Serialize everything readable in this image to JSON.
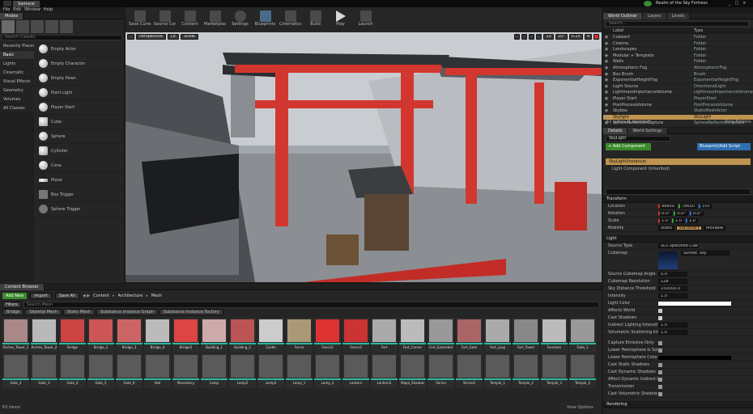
{
  "window": {
    "title": "Realm of the Sky Fortress",
    "tab": "Samurai"
  },
  "menu": [
    "File",
    "Edit",
    "Window",
    "Help"
  ],
  "modes": {
    "tab": "Modes",
    "search_placeholder": "Search Classes",
    "categories": [
      "Recently Placed",
      "Basic",
      "Lights",
      "Cinematic",
      "Visual Effects",
      "Geometry",
      "Volumes",
      "All Classes"
    ],
    "selected_category": 1,
    "items": [
      "Empty Actor",
      "Empty Character",
      "Empty Pawn",
      "Point Light",
      "Player Start",
      "Cube",
      "Sphere",
      "Cylinder",
      "Cone",
      "Plane",
      "Box Trigger",
      "Sphere Trigger"
    ]
  },
  "toolbar": [
    "Save Current",
    "Source Control",
    "Content",
    "Marketplace",
    "Settings",
    "Blueprints",
    "Cinematics",
    "Build",
    "Play",
    "Launch"
  ],
  "viewport": {
    "perspective": "Perspective",
    "lit": "Lit",
    "show": "Show",
    "scale": "10",
    "angle": "10°",
    "snap": "0.25",
    "cam": "4"
  },
  "content_browser": {
    "tab": "Content Browser",
    "add_new": "Add New",
    "import": "Import",
    "save_all": "Save All",
    "path": [
      "Content",
      "Architecture",
      "Mesh"
    ],
    "filters": "Filters",
    "search_placeholder": "Search Mesh",
    "filter_tabs": [
      "Bridge",
      "Skeletal Mesh",
      "Static Mesh",
      "Substance Instance Graph",
      "Substance Instance Factory"
    ],
    "row1": [
      "Arches_Tower_1",
      "Arches_Tower_2",
      "Bridge",
      "Bridge_2",
      "Bridge_3",
      "Bridge_4",
      "Bridge5",
      "Building_1",
      "Building_2",
      "Castle",
      "Fence",
      "Fence2",
      "Fence3",
      "Fort",
      "Fort_Corner",
      "Fort_Extended",
      "Fort_Gate",
      "Fort_Loop",
      "Fort_Tower",
      "Fountain",
      "Gate_1"
    ],
    "row2": [
      "Gate_2",
      "Gate_3",
      "Gate_4",
      "Gate_5",
      "Gate_6",
      "Hall",
      "Monastery",
      "Lamp",
      "Lamp2",
      "Lamp3",
      "Lamp_1",
      "Lamp_2",
      "Lantern",
      "Lantern2",
      "Mapo_Shadow",
      "Shrine",
      "Shrine2",
      "Temple_1",
      "Temple_2",
      "Temple_3",
      "Temple_4"
    ],
    "status": "63 items",
    "view_options": "View Options"
  },
  "outliner": {
    "tabs": [
      "World Outliner",
      "Layers",
      "Levels"
    ],
    "search_placeholder": "Search...",
    "col_label": "Label",
    "col_type": "Type",
    "rows": [
      [
        "Cubeant",
        "Folder"
      ],
      [
        "Cinema",
        "Folder"
      ],
      [
        "Landscapes",
        "Folder"
      ],
      [
        "Modular + Template",
        "Folder"
      ],
      [
        "Walls",
        "Folder"
      ],
      [
        "Atmospheric Fog",
        "AtmosphericFog"
      ],
      [
        "Box Brush",
        "Brush"
      ],
      [
        "ExponentialHeightFog",
        "ExponentialHeightFog"
      ],
      [
        "Light Source",
        "DirectionalLight"
      ],
      [
        "LightmassImportanceVolume",
        "LightmassImportanceVolume"
      ],
      [
        "Player Start",
        "PlayerStart"
      ],
      [
        "PostProcessVolume",
        "PostProcessVolume"
      ],
      [
        "Skybox",
        "StaticMeshActor"
      ],
      [
        "Skylight",
        "SkyLight"
      ],
      [
        "SphereReflectionCapture",
        "SphereReflectionCapture"
      ]
    ],
    "selected_row": 13,
    "status": "52 actors (1 selected)",
    "view_options": "View Options"
  },
  "details": {
    "tabs": [
      "Details",
      "World Settings"
    ],
    "name": "SkyLight",
    "add_component": "+ Add Component",
    "blueprint_script": "Blueprint/Add Script",
    "component": "SkyLight(Instance)",
    "sub_component": "Light Component (Inherited)",
    "transform": {
      "title": "Transform",
      "location": [
        "99600",
        "78650",
        "370"
      ],
      "rotation": [
        "0.0°",
        "0.0°",
        "0.0°"
      ],
      "scale": [
        "1.0",
        "1.0",
        "1.0"
      ],
      "mobility": [
        "Static",
        "Stationary",
        "Movable"
      ]
    },
    "light": {
      "title": "Light",
      "rows": [
        [
          "Source Type",
          "SLS Specified Cubemap"
        ],
        [
          "Cubemap",
          "Sunset_Sky"
        ],
        [
          "Source Cubemap Angle",
          "0.0"
        ],
        [
          "Cubemap Resolution",
          "128"
        ],
        [
          "Sky Distance Threshold",
          "150000.0"
        ],
        [
          "Intensity",
          "1.0"
        ],
        [
          "Light Color",
          ""
        ],
        [
          "Affects World",
          ""
        ],
        [
          "Cast Shadows",
          ""
        ],
        [
          "Indirect Lighting Intensity",
          "1.0"
        ],
        [
          "Volumetric Scattering Intensity",
          "1.0"
        ]
      ],
      "more": [
        "Capture Emissive Only",
        "Lower Hemisphere Is Solid Color",
        "Lower Hemisphere Color",
        "Cast Static Shadows",
        "Cast Dynamic Shadows",
        "Affect Dynamic Indirect Lighting",
        "Transmission",
        "Cast Volumetric Shadow"
      ]
    },
    "rendering": "Rendering"
  },
  "colors": {
    "accent": "#2fb8a6",
    "select": "#bf9350",
    "red": "#d2372f"
  }
}
